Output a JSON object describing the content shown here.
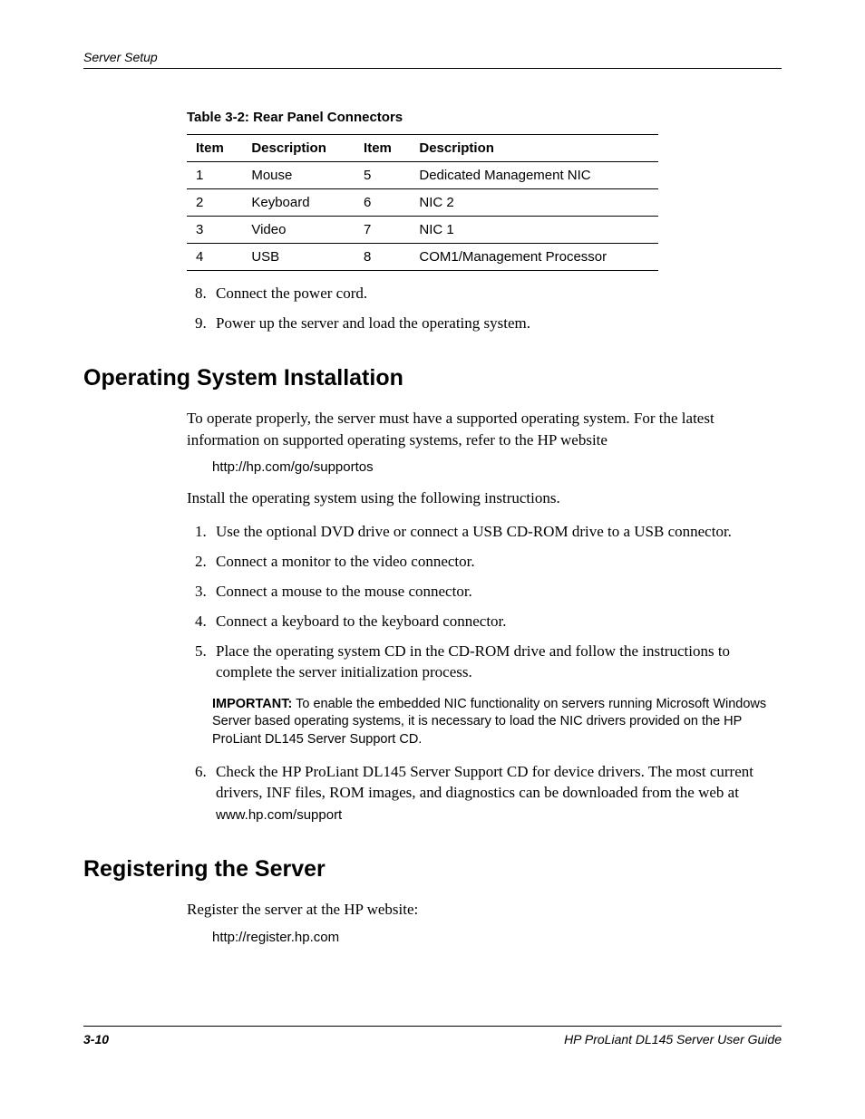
{
  "header": {
    "running": "Server Setup"
  },
  "table": {
    "title": "Table 3-2:  Rear Panel Connectors",
    "headers": [
      "Item",
      "Description",
      "Item",
      "Description"
    ],
    "rows": [
      {
        "i1": "1",
        "d1": "Mouse",
        "i2": "5",
        "d2": "Dedicated Management NIC"
      },
      {
        "i1": "2",
        "d1": "Keyboard",
        "i2": "6",
        "d2": "NIC 2"
      },
      {
        "i1": "3",
        "d1": "Video",
        "i2": "7",
        "d2": "NIC 1"
      },
      {
        "i1": "4",
        "d1": "USB",
        "i2": "8",
        "d2": "COM1/Management Processor"
      }
    ]
  },
  "steps_a": {
    "start": 8,
    "items": [
      "Connect the power cord.",
      "Power up the server and load the operating system."
    ]
  },
  "section1": {
    "heading": "Operating System Installation",
    "para1": "To operate properly, the server must have a supported operating system. For the latest information on supported operating systems, refer to the HP website",
    "url1": "http://hp.com/go/supportos",
    "para2": "Install the operating system using the following instructions.",
    "steps": [
      "Use the optional DVD drive or connect a USB CD-ROM drive to a USB connector.",
      "Connect a monitor to the video connector.",
      "Connect a mouse to the mouse connector.",
      "Connect a keyboard to the keyboard connector.",
      "Place the operating system CD in the CD-ROM drive and follow the instructions to complete the server initialization process."
    ],
    "note_label": "IMPORTANT:",
    "note_text": "  To enable the embedded NIC functionality on servers running Microsoft Windows Server based operating systems, it is necessary to load the NIC drivers provided on the HP ProLiant DL145 Server Support CD.",
    "step6": "Check the HP ProLiant DL145 Server Support CD for device drivers. The most current drivers, INF files, ROM images, and diagnostics can be downloaded from the web at",
    "url2": "www.hp.com/support"
  },
  "section2": {
    "heading": "Registering the Server",
    "para": "Register the server at the HP website:",
    "url": "http://register.hp.com"
  },
  "footer": {
    "page": "3-10",
    "doc": "HP ProLiant DL145 Server User Guide"
  }
}
